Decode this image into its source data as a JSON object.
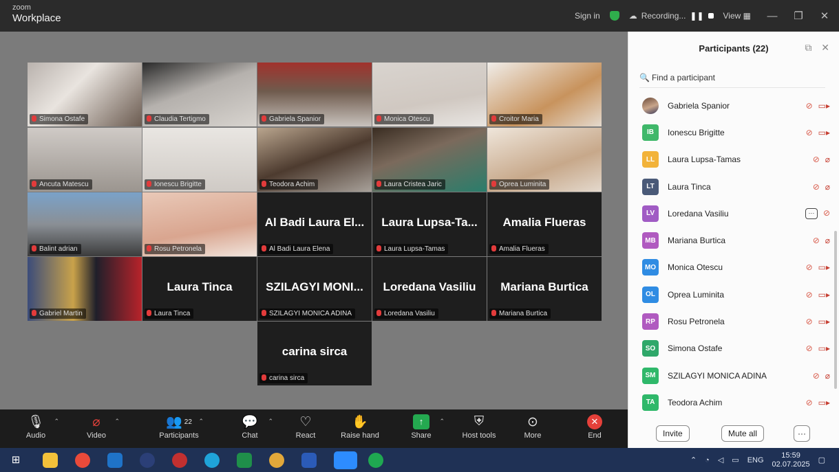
{
  "app": {
    "brand_top": "zoom",
    "brand_bottom": "Workplace"
  },
  "titlebar": {
    "sign_in": "Sign in",
    "recording": "Recording...",
    "view": "View"
  },
  "tiles": [
    {
      "name": "Simona Ostafe",
      "video": true,
      "bg": "linear-gradient(135deg,#b9b2ad 0%,#e9e4df 40%,#6a5a4f 100%)"
    },
    {
      "name": "Claudia Tertigmo",
      "video": true,
      "bg": "linear-gradient(160deg,#2a2a2a 0%,#b5b1ad 45%,#d8d4cf 100%)"
    },
    {
      "name": "Gabriela Spanior",
      "video": true,
      "bg": "linear-gradient(180deg,#a1312c 0%,#6f5b4d 45%,#c8c2bd 100%)"
    },
    {
      "name": "Monica Otescu",
      "video": true,
      "bg": "linear-gradient(170deg,#d9d4cf 0%,#d0c8c1 60%,#e9e6e3 100%)"
    },
    {
      "name": "Croitor Maria",
      "video": true,
      "bg": "linear-gradient(150deg,#f0ede9 0%,#c8935d 60%,#e4d9cd 100%)"
    },
    {
      "name": "Ancuta Matescu",
      "video": true,
      "bg": "linear-gradient(180deg,#cfcac6 0%,#9b958f 100%)"
    },
    {
      "name": "Ionescu Brigitte",
      "video": true,
      "bg": "linear-gradient(180deg,#e9e6e2 0%,#cfcac5 100%)"
    },
    {
      "name": "Teodora Achim",
      "video": true,
      "bg": "linear-gradient(160deg,#b9a58e 0%,#4d3b2f 50%,#a8a19a 100%)"
    },
    {
      "name": "Laura Cristea Jaric",
      "video": true,
      "active": true,
      "bg": "linear-gradient(160deg,#3a2d22 0%,#7b6a5c 40%,#2a7d6b 100%)"
    },
    {
      "name": "Oprea Luminita",
      "video": true,
      "bg": "linear-gradient(160deg,#efe6db 0%,#c7a88a 60%,#e4d9cd 100%)"
    },
    {
      "name": "Balint adrian",
      "video": true,
      "bg": "linear-gradient(180deg,#7aa2c9 0%,#8a8f95 50%,#3c3c3c 100%)"
    },
    {
      "name": "Rosu Petronela",
      "video": true,
      "bg": "linear-gradient(170deg,#e9c9b8 0%,#d9a58f 60%,#f1e5dd 100%)"
    },
    {
      "name": "Al Badi Laura Elena",
      "big": "Al Badi Laura El...",
      "video": false
    },
    {
      "name": "Laura Lupsa-Tamas",
      "big": "Laura  Lupsa-Ta...",
      "video": false
    },
    {
      "name": "Amalia Flueras",
      "big": "Amalia Flueras",
      "video": false
    },
    {
      "name": "Gabriel Martin",
      "video": true,
      "bg": "linear-gradient(90deg,#3b4c7a 0%,#c9a24a 40%,#1f1f2a 60%,#b8232a 100%)"
    },
    {
      "name": "Laura Tinca",
      "big": "Laura Tinca",
      "video": false
    },
    {
      "name": "SZILAGYI MONICA ADINA",
      "big": "SZILAGYI  MONI...",
      "video": false
    },
    {
      "name": "Loredana Vasiliu",
      "big": "Loredana Vasiliu",
      "video": false
    },
    {
      "name": "Mariana Burtica",
      "big": "Mariana Burtica",
      "video": false
    },
    {
      "name": "carina sirca",
      "big": "carina sirca",
      "video": false
    }
  ],
  "toolbar": {
    "audio": "Audio",
    "video": "Video",
    "participants": "Participants",
    "participants_count": "22",
    "chat": "Chat",
    "react": "React",
    "raise_hand": "Raise hand",
    "share": "Share",
    "host_tools": "Host tools",
    "more": "More",
    "end": "End"
  },
  "panel": {
    "title": "Participants (22)",
    "search_placeholder": "Find a participant",
    "invite": "Invite",
    "mute_all": "Mute all",
    "participants": [
      {
        "initials": "",
        "name": "Gabriela Spanior",
        "color": "",
        "photo": true,
        "video_on": true
      },
      {
        "initials": "IB",
        "name": "Ionescu Brigitte",
        "color": "#3fb86a",
        "video_on": true
      },
      {
        "initials": "LL",
        "name": "Laura Lupsa-Tamas",
        "color": "#f2b33a",
        "video_on": false
      },
      {
        "initials": "LT",
        "name": "Laura Tinca",
        "color": "#4a5a78",
        "video_on": false
      },
      {
        "initials": "LV",
        "name": "Loredana Vasiliu",
        "color": "#a05bc4",
        "video_on": false,
        "more": true
      },
      {
        "initials": "MB",
        "name": "Mariana Burtica",
        "color": "#b05ac0",
        "video_on": false
      },
      {
        "initials": "MO",
        "name": "Monica Otescu",
        "color": "#2f8ce3",
        "video_on": true
      },
      {
        "initials": "OL",
        "name": "Oprea Luminita",
        "color": "#2f8ce3",
        "video_on": true
      },
      {
        "initials": "RP",
        "name": "Rosu Petronela",
        "color": "#b05ac0",
        "video_on": true
      },
      {
        "initials": "SO",
        "name": "Simona Ostafe",
        "color": "#2fa86a",
        "video_on": true
      },
      {
        "initials": "SM",
        "name": "SZILAGYI MONICA ADINA",
        "color": "#2fb86a",
        "video_on": false
      },
      {
        "initials": "TA",
        "name": "Teodora Achim",
        "color": "#2fb86a",
        "video_on": true
      }
    ]
  },
  "taskbar": {
    "lang": "ENG",
    "time": "15:59",
    "date": "02.07.2025"
  }
}
